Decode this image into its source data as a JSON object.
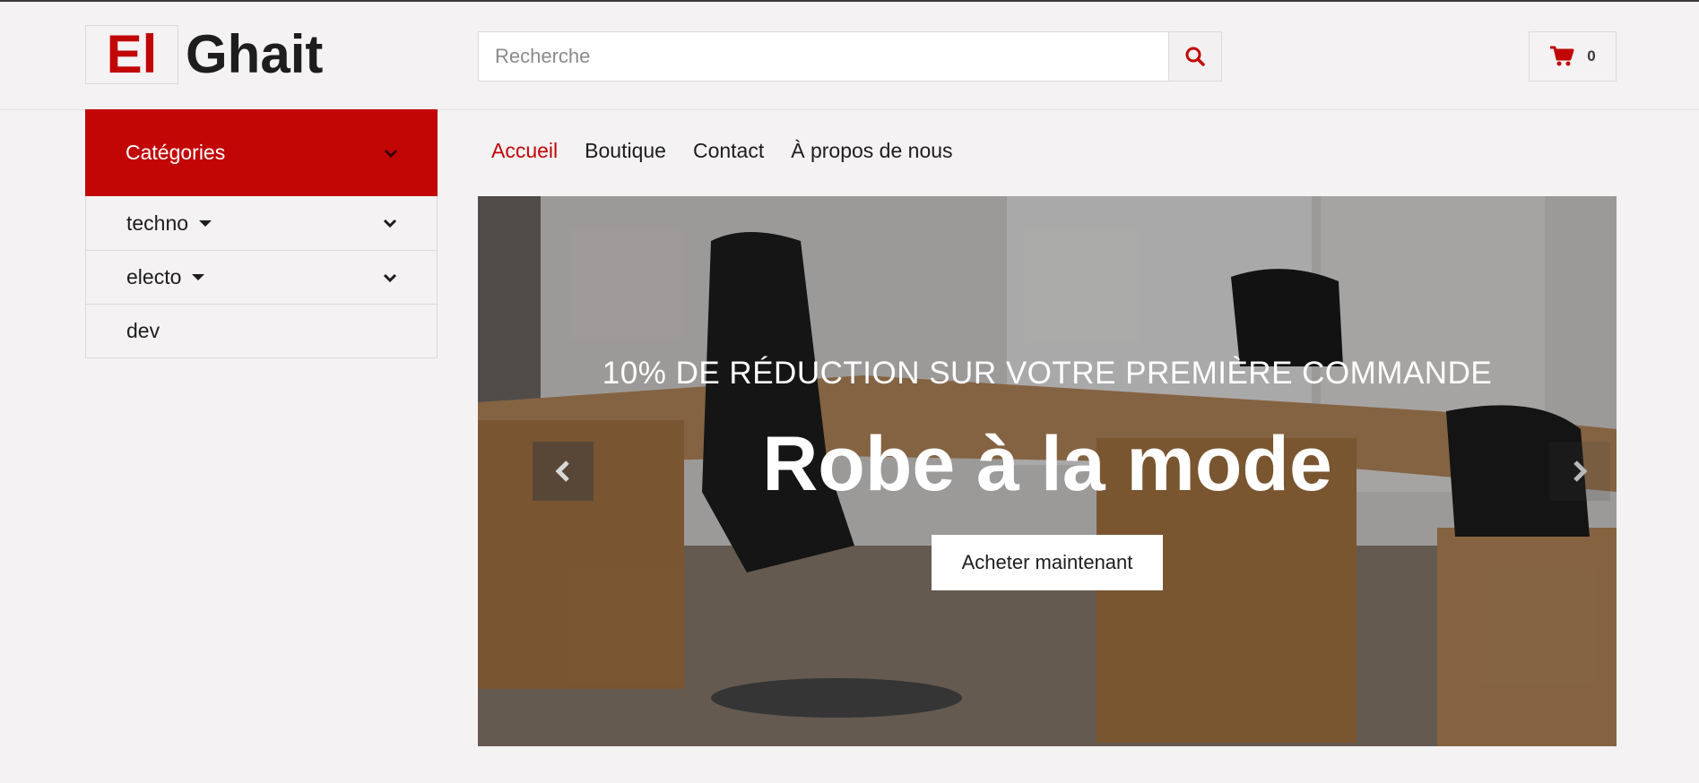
{
  "brand": {
    "logo_first": "El",
    "logo_second": "Ghait"
  },
  "search": {
    "placeholder": "Recherche",
    "value": ""
  },
  "cart": {
    "count": "0"
  },
  "colors": {
    "accent": "#c20606",
    "background": "#f4f2f3",
    "border": "#dcd9da"
  },
  "icons": {
    "search": "search-icon",
    "cart": "shopping-cart-icon",
    "chevron": "chevron-down-icon",
    "caret": "caret-down-icon",
    "prev": "chevron-left-icon",
    "next": "chevron-right-icon"
  },
  "sidebar": {
    "header_label": "Catégories",
    "items": [
      {
        "label": "techno",
        "has_submenu": true
      },
      {
        "label": "electo",
        "has_submenu": true
      },
      {
        "label": "dev",
        "has_submenu": false
      }
    ]
  },
  "nav": {
    "items": [
      {
        "label": "Accueil",
        "active": true
      },
      {
        "label": "Boutique",
        "active": false
      },
      {
        "label": "Contact",
        "active": false
      },
      {
        "label": "À propos de nous",
        "active": false
      }
    ]
  },
  "hero": {
    "subtitle": "10% DE RÉDUCTION SUR VOTRE PREMIÈRE COMMANDE",
    "title": "Robe à la mode",
    "button_label": "Acheter maintenant"
  }
}
